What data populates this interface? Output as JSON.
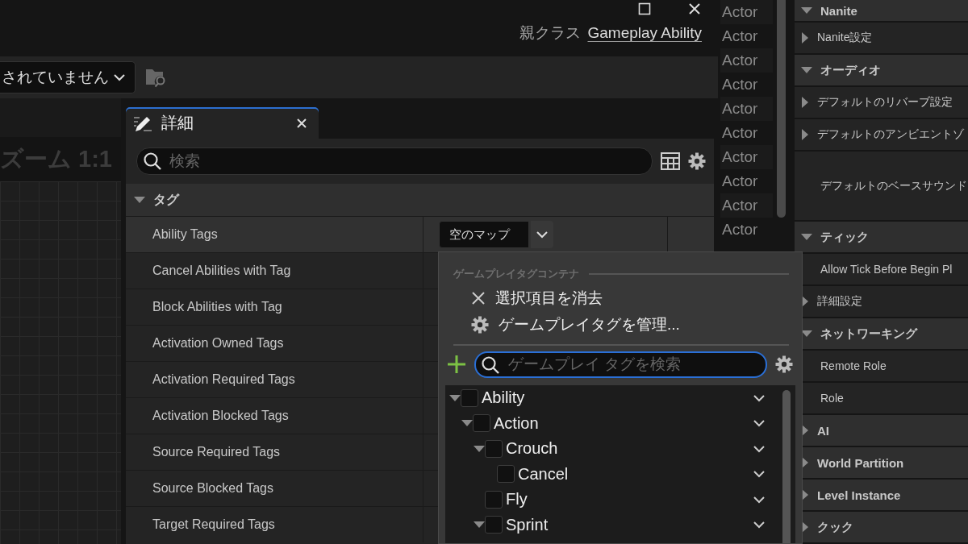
{
  "window": {
    "controls": [
      {
        "kind": "maximize"
      },
      {
        "kind": "close"
      }
    ],
    "parent_class_label": "親クラス",
    "parent_class": "Gameplay Ability"
  },
  "toolbar": {
    "dropdown": "されていません"
  },
  "graph": {
    "zoom_label": "ズーム 1:1"
  },
  "details": {
    "tab": {
      "title": "詳細",
      "selected": true
    },
    "search": {
      "placeholder": "検索"
    },
    "category": {
      "title": "タグ",
      "expanded": true
    },
    "rows": [
      {
        "label": "Ability Tags",
        "value": "空のマップ",
        "hovered": true
      },
      {
        "label": "Cancel Abilities with Tag",
        "hovered": false
      },
      {
        "label": "Block Abilities with Tag",
        "hovered": false
      },
      {
        "label": "Activation Owned Tags",
        "hovered": false
      },
      {
        "label": "Activation Required Tags",
        "hovered": false
      },
      {
        "label": "Activation Blocked Tags",
        "hovered": false
      },
      {
        "label": "Source Required Tags",
        "hovered": false
      },
      {
        "label": "Source Blocked Tags",
        "hovered": false
      },
      {
        "label": "Target Required Tags",
        "hovered": false
      }
    ]
  },
  "actor_list": [
    "Actor",
    "Actor",
    "Actor",
    "Actor",
    "Actor",
    "Actor",
    "Actor",
    "Actor",
    "Actor",
    "Actor"
  ],
  "right_panel": {
    "rows": [
      {
        "kind": "category",
        "label": "Nanite",
        "expanded": true
      },
      {
        "kind": "group",
        "label": "Nanite設定",
        "expanded": false
      },
      {
        "kind": "category",
        "label": "オーディオ",
        "expanded": true
      },
      {
        "kind": "group",
        "label": "デフォルトのリバーブ設定",
        "expanded": false
      },
      {
        "kind": "group",
        "label": "デフォルトのアンビエントゾ",
        "expanded": false
      },
      {
        "kind": "tall",
        "label": "デフォルトのベースサウンド"
      },
      {
        "kind": "category",
        "label": "ティック",
        "expanded": true
      },
      {
        "kind": "property",
        "label": "Allow Tick Before Begin Pl"
      },
      {
        "kind": "group",
        "label": "詳細設定",
        "expanded": false
      },
      {
        "kind": "category",
        "label": "ネットワーキング",
        "expanded": true
      },
      {
        "kind": "property",
        "label": "Remote Role"
      },
      {
        "kind": "property",
        "label": "Role"
      },
      {
        "kind": "category",
        "label": "AI",
        "expanded": false
      },
      {
        "kind": "category",
        "label": "World Partition",
        "expanded": false
      },
      {
        "kind": "category",
        "label": "Level Instance",
        "expanded": false
      },
      {
        "kind": "category",
        "label": "クック",
        "expanded": false
      }
    ]
  },
  "tag_menu": {
    "section": "ゲームプレイタグコンテナ",
    "actions": [
      {
        "kind": "clear",
        "label": "選択項目を消去"
      },
      {
        "kind": "manage",
        "label": "ゲームプレイタグを管理..."
      }
    ],
    "search": {
      "placeholder": "ゲームプレイ タグを検索"
    },
    "tree": [
      {
        "label": "Ability",
        "kind": "branch",
        "expanded": true,
        "checked": false,
        "children": [
          {
            "label": "Action",
            "kind": "branch",
            "expanded": true,
            "checked": false,
            "children": [
              {
                "label": "Crouch",
                "kind": "branch",
                "expanded": true,
                "checked": false,
                "children": [
                  {
                    "label": "Cancel",
                    "kind": "leaf",
                    "checked": false
                  }
                ]
              },
              {
                "label": "Fly",
                "kind": "leaf",
                "checked": false
              },
              {
                "label": "Sprint",
                "kind": "branch",
                "expanded": true,
                "checked": false
              }
            ]
          }
        ]
      }
    ]
  }
}
